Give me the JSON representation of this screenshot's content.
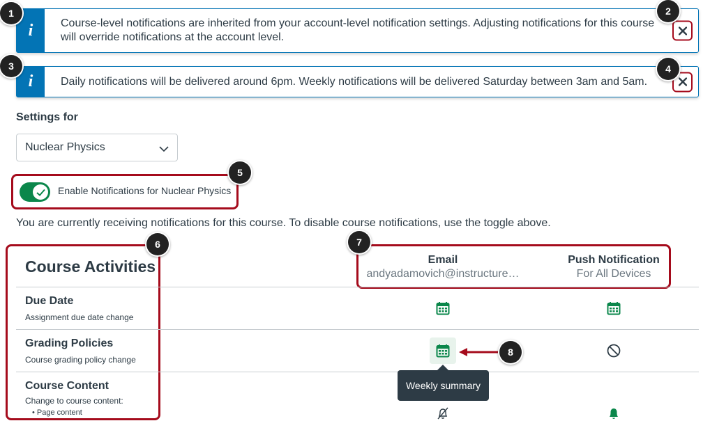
{
  "alerts": [
    {
      "icon": "info-icon",
      "glyph": "i",
      "text": "Course-level notifications are inherited from your account-level notification settings. Adjusting notifications for this course will override notifications at the account level.",
      "close_icon": "close-icon"
    },
    {
      "icon": "info-icon",
      "glyph": "i",
      "text": "Daily notifications will be delivered around 6pm. Weekly notifications will be delivered Saturday between 3am and 5am.",
      "close_icon": "close-icon"
    }
  ],
  "settings": {
    "label": "Settings for",
    "course_select_value": "Nuclear Physics"
  },
  "toggle": {
    "label": "Enable Notifications for Nuclear Physics",
    "state": "on"
  },
  "info_text": "You are currently receiving notifications for this course. To disable course notifications, use the toggle above.",
  "table": {
    "title": "Course Activities",
    "columns": [
      {
        "title": "Email",
        "subtitle": "andyadamovich@instructure…"
      },
      {
        "title": "Push Notification",
        "subtitle": "For All Devices"
      }
    ],
    "rows": [
      {
        "title": "Due Date",
        "description": "Assignment due date change",
        "email_icon": "calendar-icon",
        "push_icon": "calendar-icon"
      },
      {
        "title": "Grading Policies",
        "description": "Course grading policy change",
        "email_icon": "calendar-icon",
        "push_icon": "prohibited-icon"
      },
      {
        "title": "Course Content",
        "description": "Change to course content:",
        "bullet": "Page content",
        "email_icon": "bell-off-icon",
        "push_icon": "bell-icon"
      }
    ]
  },
  "tooltip": "Weekly summary",
  "callouts": [
    "1",
    "2",
    "3",
    "4",
    "5",
    "6",
    "7",
    "8"
  ],
  "colors": {
    "accent": "#0374b5",
    "success": "#0b874b",
    "highlight": "#a50b1c",
    "text": "#2d3b45",
    "muted": "#6b7780"
  }
}
